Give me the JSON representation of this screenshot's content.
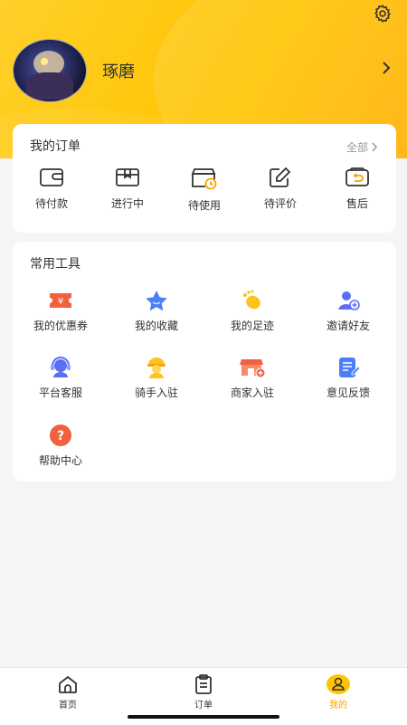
{
  "profile": {
    "username": "琢磨"
  },
  "orders": {
    "title": "我的订单",
    "all_label": "全部",
    "items": [
      {
        "label": "待付款",
        "icon": "wallet-icon"
      },
      {
        "label": "进行中",
        "icon": "package-icon"
      },
      {
        "label": "待使用",
        "icon": "pending-use-icon"
      },
      {
        "label": "待评价",
        "icon": "edit-review-icon"
      },
      {
        "label": "售后",
        "icon": "after-sales-icon"
      }
    ]
  },
  "tools": {
    "title": "常用工具",
    "items": [
      {
        "label": "我的优惠券",
        "icon": "coupon-icon",
        "color": "#f0613f"
      },
      {
        "label": "我的收藏",
        "icon": "star-icon",
        "color": "#4c7ef6"
      },
      {
        "label": "我的足迹",
        "icon": "footprint-icon",
        "color": "#ffc21a"
      },
      {
        "label": "邀请好友",
        "icon": "invite-friend-icon",
        "color": "#5a6ff2"
      },
      {
        "label": "平台客服",
        "icon": "customer-service-icon",
        "color": "#5a6ff2"
      },
      {
        "label": "骑手入驻",
        "icon": "rider-icon",
        "color": "#ffc21a"
      },
      {
        "label": "商家入驻",
        "icon": "merchant-icon",
        "color": "#f0613f"
      },
      {
        "label": "意见反馈",
        "icon": "feedback-icon",
        "color": "#4c7ef6"
      },
      {
        "label": "帮助中心",
        "icon": "help-icon",
        "color": "#f0613f"
      }
    ]
  },
  "tabbar": {
    "tabs": [
      {
        "label": "首页",
        "icon": "home-icon"
      },
      {
        "label": "订单",
        "icon": "order-clipboard-icon"
      },
      {
        "label": "我的",
        "icon": "profile-icon",
        "active": true
      }
    ]
  },
  "colors": {
    "accent": "#ffc400",
    "active_tab": "#f5a400"
  }
}
